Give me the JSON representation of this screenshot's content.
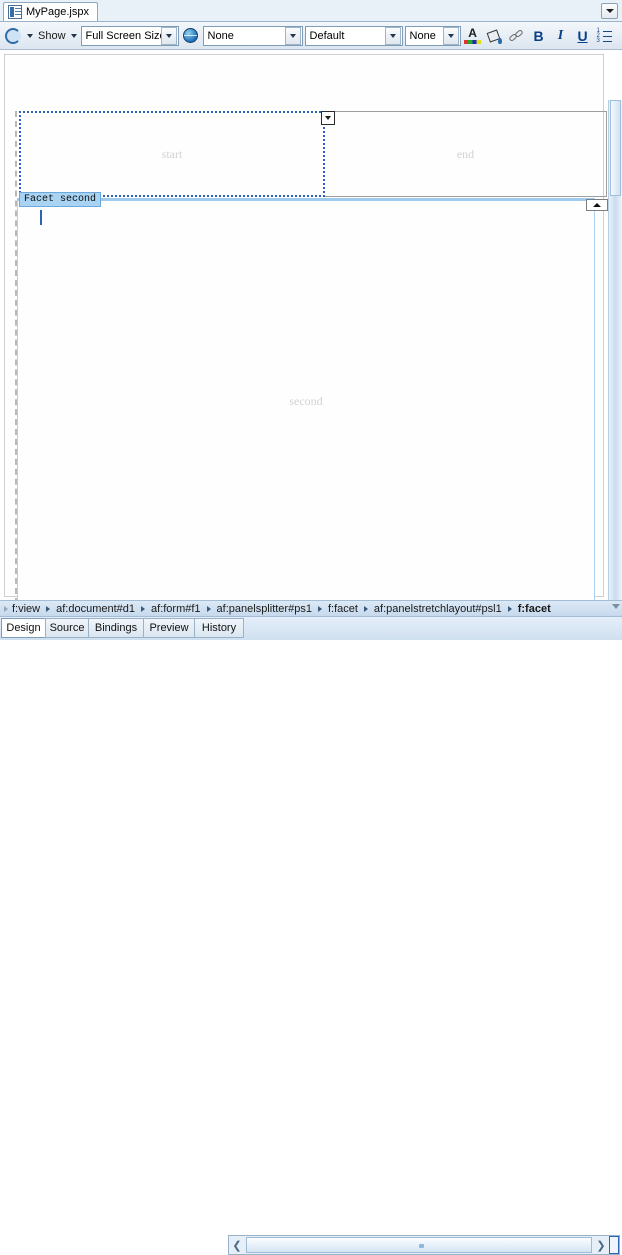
{
  "window": {
    "document_tab": {
      "label": "MyPage.jspx",
      "icon": "jspx-document-icon"
    },
    "tabbar_dropdown_icon": "chevron-down-icon"
  },
  "toolbar": {
    "refresh_icon": "refresh-page-icon",
    "refresh_dropdown_icon": "chevron-down-icon",
    "show_label": "Show",
    "show_dropdown_icon": "chevron-down-icon",
    "screen_size": {
      "value": "Full Screen Size",
      "dropdown_icon": "chevron-down-icon"
    },
    "browser_icon": "globe-icon",
    "skin_family": {
      "value": "None",
      "dropdown_icon": "chevron-down-icon"
    },
    "style_class": {
      "value": "Default",
      "dropdown_icon": "chevron-down-icon"
    },
    "font_size": {
      "value": "None",
      "dropdown_icon": "chevron-down-icon"
    },
    "font_color_icon": "font-color-icon",
    "background_color_icon": "fill-color-icon",
    "link_icon": "hyperlink-icon",
    "bold_label": "B",
    "italic_label": "I",
    "underline_label": "U",
    "list_icon": "ordered-list-icon"
  },
  "canvas": {
    "splitter": {
      "start_facet_label": "start",
      "end_facet_label": "end",
      "collapse_handle_icon": "chevron-down-icon"
    },
    "selected_facet": {
      "tag_label": "Facet second",
      "placeholder_label": "second",
      "scroll_up_icon": "triangle-up-icon"
    }
  },
  "breadcrumb": {
    "leading_icon": "triangle-right-icon",
    "items": [
      {
        "label": "f:view",
        "current": false
      },
      {
        "label": "af:document#d1",
        "current": false
      },
      {
        "label": "af:form#f1",
        "current": false
      },
      {
        "label": "af:panelsplitter#ps1",
        "current": false
      },
      {
        "label": "f:facet",
        "current": false
      },
      {
        "label": "af:panelstretchlayout#psl1",
        "current": false
      },
      {
        "label": "f:facet",
        "current": true
      }
    ],
    "overflow_icon": "chevron-down-icon"
  },
  "editor_tabs": {
    "items": [
      {
        "label": "Design",
        "active": true
      },
      {
        "label": "Source",
        "active": false
      },
      {
        "label": "Bindings",
        "active": false
      },
      {
        "label": "Preview",
        "active": false
      },
      {
        "label": "History",
        "active": false
      }
    ]
  },
  "scrollbars": {
    "horizontal_left_icon": "chevron-left-icon",
    "horizontal_right_icon": "chevron-right-icon"
  },
  "colors": {
    "selection_blue": "#2f63b5",
    "facet_tag_bg": "#a8d3f2",
    "placeholder_gray": "#d2d2d2",
    "toolbar_accent": "#0b3f87"
  }
}
